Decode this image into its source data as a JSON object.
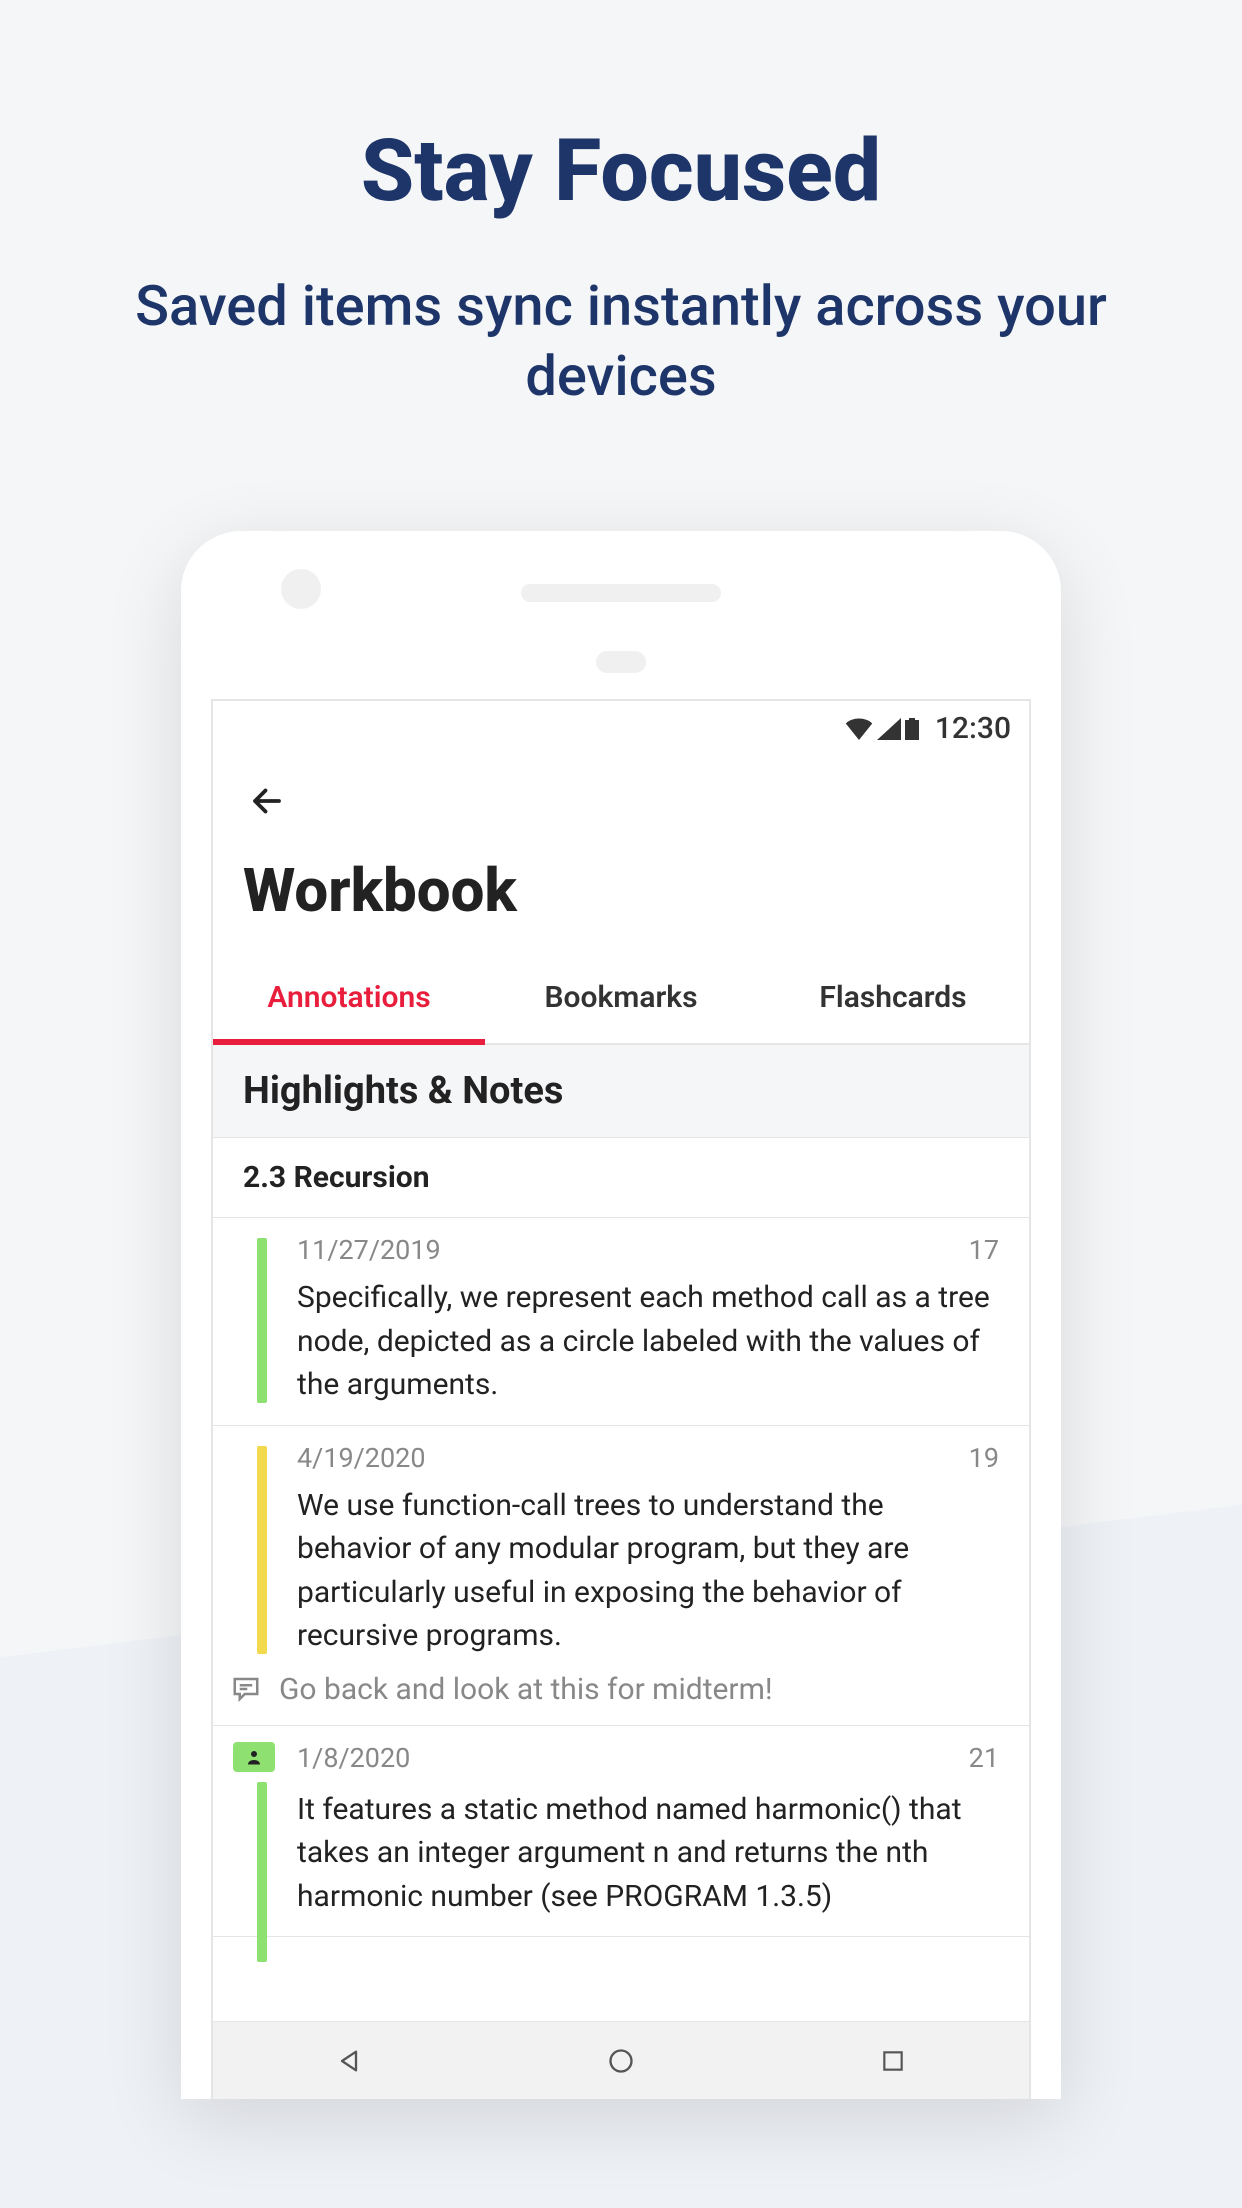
{
  "hero": {
    "title": "Stay Focused",
    "subtitle": "Saved items sync instantly across your devices"
  },
  "status": {
    "time": "12:30"
  },
  "header": {
    "title": "Workbook"
  },
  "tabs": {
    "annotations": "Annotations",
    "bookmarks": "Bookmarks",
    "flashcards": "Flashcards"
  },
  "section": {
    "title": "Highlights & Notes",
    "chapter": "2.3 Recursion"
  },
  "notes": [
    {
      "date": "11/27/2019",
      "page": "17",
      "color": "green",
      "text": "Specifically, we represent each method call as a tree node, depicted as a circle labeled with the values of the arguments."
    },
    {
      "date": "4/19/2020",
      "page": "19",
      "color": "yellow",
      "text": "We use function-call trees to understand the behavior of any modular program, but they are particularly useful in exposing the behavior of recursive programs.",
      "comment": "Go back and look at this for midterm!"
    },
    {
      "date": "1/8/2020",
      "page": "21",
      "color": "green",
      "badge": true,
      "text": "It features a static method named harmonic() that takes an integer argument n and returns the nth harmonic number (see PROGRAM 1.3.5)"
    }
  ]
}
